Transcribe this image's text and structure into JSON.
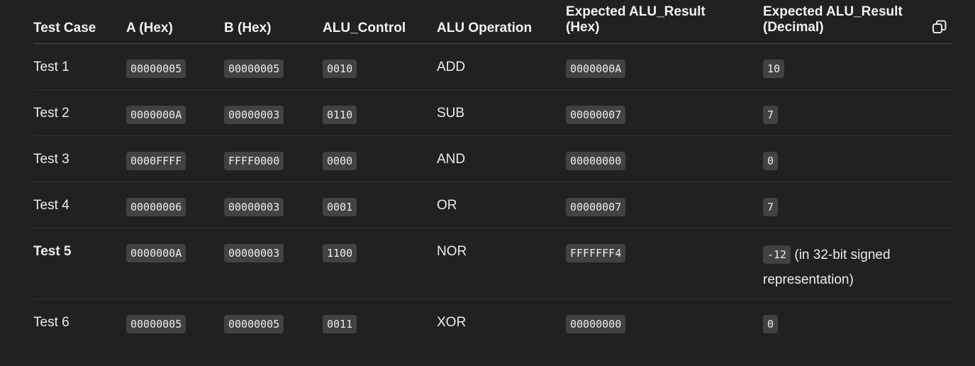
{
  "headers": {
    "test_case": "Test Case",
    "a_hex": "A (Hex)",
    "b_hex": "B (Hex)",
    "alu_control": "ALU_Control",
    "alu_operation": "ALU Operation",
    "expected_hex_line1": "Expected ALU_Result",
    "expected_hex_line2": "(Hex)",
    "expected_dec_line1": "Expected ALU_Result",
    "expected_dec_line2": "(Decimal)"
  },
  "rows": [
    {
      "test": "Test 1",
      "a": "00000005",
      "b": "00000005",
      "control": "0010",
      "op": "ADD",
      "hex": "0000000A",
      "dec": "10"
    },
    {
      "test": "Test 2",
      "a": "0000000A",
      "b": "00000003",
      "control": "0110",
      "op": "SUB",
      "hex": "00000007",
      "dec": "7"
    },
    {
      "test": "Test 3",
      "a": "0000FFFF",
      "b": "FFFF0000",
      "control": "0000",
      "op": "AND",
      "hex": "00000000",
      "dec": "0"
    },
    {
      "test": "Test 4",
      "a": "00000006",
      "b": "00000003",
      "control": "0001",
      "op": "OR",
      "hex": "00000007",
      "dec": "7"
    },
    {
      "test": "Test 5",
      "a": "0000000A",
      "b": "00000003",
      "control": "1100",
      "op": "NOR",
      "hex": "FFFFFFF4",
      "dec": "-12",
      "dec_note": "(in 32-bit signed representation)"
    },
    {
      "test": "Test 6",
      "a": "00000005",
      "b": "00000005",
      "control": "0011",
      "op": "XOR",
      "hex": "00000000",
      "dec": "0"
    }
  ],
  "copy_icon": "copy-icon"
}
